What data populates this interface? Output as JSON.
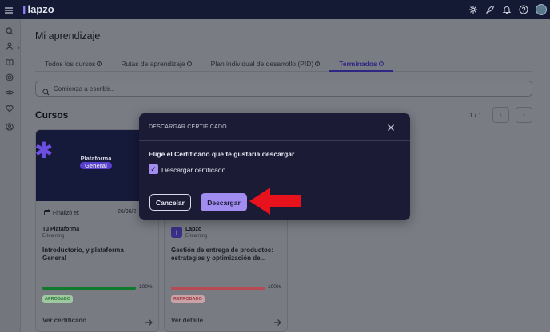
{
  "app": {
    "name": "lapzo",
    "logo_mark": "ꞁ"
  },
  "topbar": {
    "icons": [
      "menu-icon",
      "sparkle-icon",
      "rocket-icon",
      "bell-icon",
      "help-icon",
      "avatar"
    ]
  },
  "sidebar": {
    "items": [
      "search-icon",
      "user-icon",
      "book-icon",
      "target-icon",
      "eye-icon",
      "heart-icon",
      "team-icon"
    ]
  },
  "page": {
    "title": "Mi aprendizaje"
  },
  "tabs": [
    {
      "label": "Todos los cursos",
      "active": false
    },
    {
      "label": "Rutas de aprendizaje",
      "active": false
    },
    {
      "label": "Plan individual de desarrollo (PID)",
      "active": false
    },
    {
      "label": "Terminados",
      "active": true
    }
  ],
  "search": {
    "placeholder": "Comienza a escribir..."
  },
  "courses": {
    "section_title": "Cursos",
    "pager": {
      "text": "1 / 1",
      "prev": "‹",
      "next": "›"
    },
    "cards": [
      {
        "thumb_title": "Plataforma",
        "thumb_subtitle": "General",
        "finish_label": "Finalizó el:",
        "finish_date": "26/06/2",
        "org_name": "Tu Plataforma",
        "org_type": "E-learning",
        "title": "Introductorio, y plataforma General",
        "progress": 100,
        "progress_text": "100%",
        "progress_color": "#0f7a2c",
        "status": "APROBADO",
        "status_color": "#2f7a3a",
        "status_bg": "#9ec89f",
        "link": "Ver certificado"
      },
      {
        "org_name": "Lapzo",
        "org_type": "E-learning",
        "title": "Gestión de entrega de productos: estrategias y optimización de...",
        "progress": 100,
        "progress_text": "100%",
        "progress_color": "#b84b52",
        "status": "REPROBADO",
        "status_color": "#a03d46",
        "status_bg": "#c9a2a6",
        "link": "Ver detalle"
      }
    ]
  },
  "modal": {
    "title": "DESCARGAR CERTIFICADO",
    "question": "Elige el Certificado que te gustaría descargar",
    "checkbox_label": "Descargar certificado",
    "checkbox_checked": true,
    "cancel_label": "Cancelar",
    "download_label": "Descargar"
  },
  "colors": {
    "accent": "#a18cf0",
    "topbar": "#141a33",
    "modal_bg": "#1b1b35",
    "annotation_arrow": "#e8121c"
  }
}
